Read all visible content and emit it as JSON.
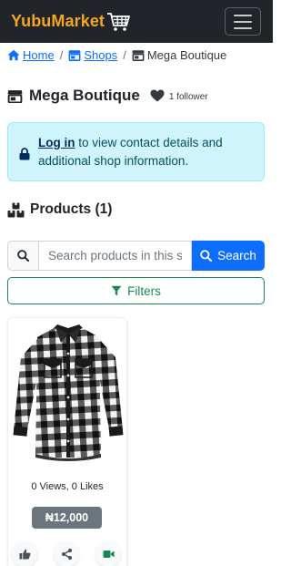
{
  "navbar": {
    "brand": "YubuMarket",
    "brand_color": "#f5a623",
    "cart_icon": "shopping-cart-icon",
    "menu_icon": "hamburger-icon"
  },
  "breadcrumb": {
    "home": "Home",
    "shops": "Shops",
    "current": "Mega Boutique",
    "separator": "/"
  },
  "shop": {
    "name": "Mega Boutique",
    "followers": "1 follower"
  },
  "alert": {
    "link": "Log in",
    "message": " to view contact details and additional shop information."
  },
  "products": {
    "heading": "Products (1)"
  },
  "search": {
    "placeholder": "Search products in this shop...",
    "button": "Search"
  },
  "filters": {
    "label": "Filters"
  },
  "product_cards": [
    {
      "image": "plaid-shirt-image",
      "stats": "0 Views, 0 Likes",
      "price": "₦12,000",
      "actions": [
        "like-icon",
        "share-icon",
        "video-icon"
      ]
    }
  ],
  "colors": {
    "primary": "#0d6efd",
    "success": "#198754",
    "info_bg": "#cff4fc",
    "navbar_bg": "#212529",
    "price_badge": "#6c757d"
  }
}
